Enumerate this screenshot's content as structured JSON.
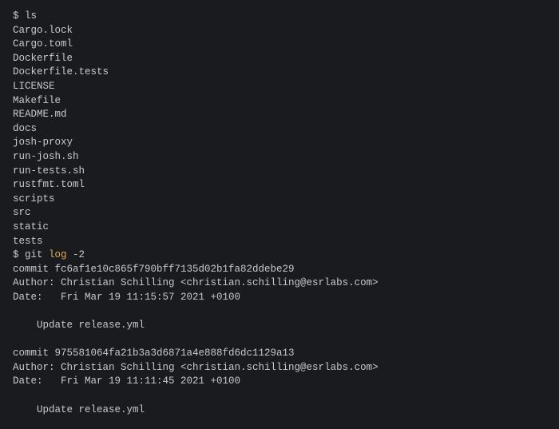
{
  "prompt": "$ ",
  "cmd_ls": "ls",
  "ls_output": [
    "Cargo.lock",
    "Cargo.toml",
    "Dockerfile",
    "Dockerfile.tests",
    "LICENSE",
    "Makefile",
    "README.md",
    "docs",
    "josh-proxy",
    "run-josh.sh",
    "run-tests.sh",
    "rustfmt.toml",
    "scripts",
    "src",
    "static",
    "tests"
  ],
  "cmd_git_prefix": "git ",
  "cmd_git_kw": "log",
  "cmd_git_suffix": " -2",
  "commits": [
    {
      "hash_line": "commit fc6af1e10c865f790bff7135d02b1fa82ddebe29",
      "author_line": "Author: Christian Schilling <christian.schilling@esrlabs.com>",
      "date_line": "Date:   Fri Mar 19 11:15:57 2021 +0100",
      "msg_line": "    Update release.yml"
    },
    {
      "hash_line": "commit 975581064fa21b3a3d6871a4e888fd6dc1129a13",
      "author_line": "Author: Christian Schilling <christian.schilling@esrlabs.com>",
      "date_line": "Date:   Fri Mar 19 11:11:45 2021 +0100",
      "msg_line": "    Update release.yml"
    }
  ]
}
